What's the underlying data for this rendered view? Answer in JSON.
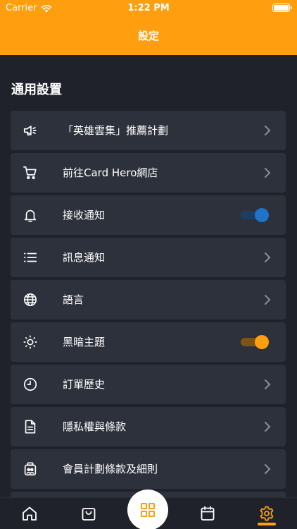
{
  "status_bar": {
    "carrier": "Carrier",
    "time": "1:22 PM"
  },
  "header": {
    "title": "設定"
  },
  "section": {
    "title": "通用設置"
  },
  "colors": {
    "accent": "#ff9e0f",
    "background": "#1f222a",
    "row": "#2d313b",
    "toggle_blue": "#1f73c9",
    "toggle_orange": "#ff9e0f"
  },
  "settings": {
    "items": [
      {
        "label": "「英雄雲集」推薦計劃",
        "icon": "megaphone-icon",
        "control": "chevron"
      },
      {
        "label": "前往Card Hero網店",
        "icon": "cart-icon",
        "control": "chevron"
      },
      {
        "label": "接收通知",
        "icon": "bell-icon",
        "control": "toggle",
        "on": true
      },
      {
        "label": "訊息通知",
        "icon": "list-icon",
        "control": "chevron"
      },
      {
        "label": "語言",
        "icon": "globe-icon",
        "control": "chevron"
      },
      {
        "label": "黑暗主題",
        "icon": "sun-icon",
        "control": "toggle",
        "on": true
      },
      {
        "label": "訂單歷史",
        "icon": "clock-icon",
        "control": "chevron"
      },
      {
        "label": "隱私權與條款",
        "icon": "document-icon",
        "control": "chevron"
      },
      {
        "label": "會員計劃條款及細則",
        "icon": "membership-icon",
        "control": "chevron"
      }
    ]
  },
  "tab_bar": {
    "tabs": [
      {
        "icon": "home-icon"
      },
      {
        "icon": "shopping-bag-icon"
      },
      {
        "icon": "grid-icon"
      },
      {
        "icon": "calendar-icon"
      },
      {
        "icon": "gear-icon",
        "active": true
      }
    ]
  }
}
